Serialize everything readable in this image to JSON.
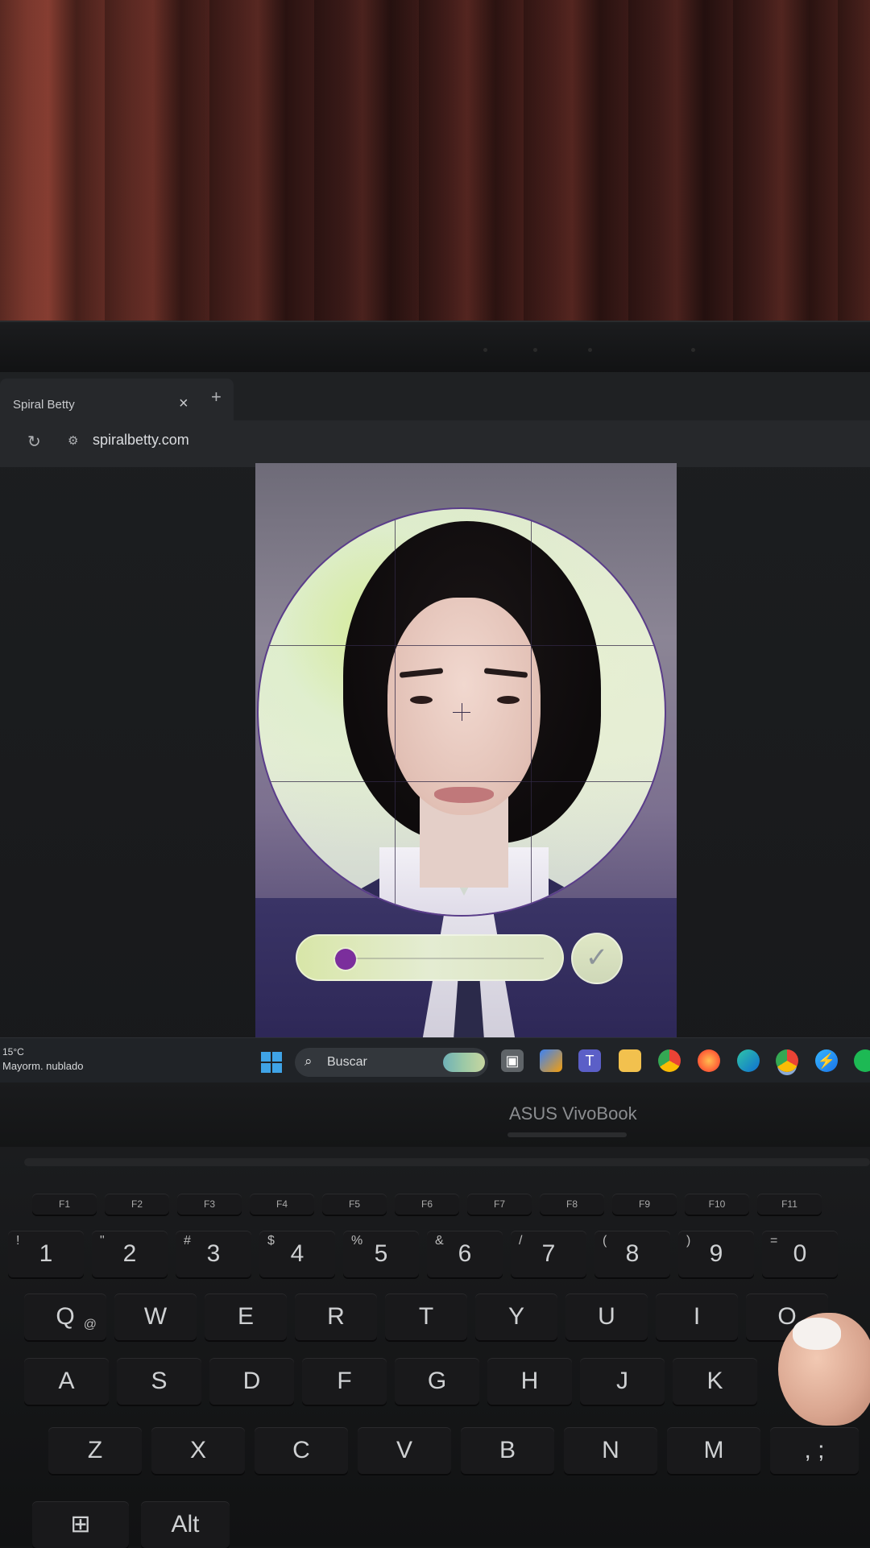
{
  "browser": {
    "tab_title": "Spiral Betty",
    "tab_close": "×",
    "new_tab": "+",
    "reload_icon": "reload-icon",
    "site_info_icon": "tune-icon",
    "url": "spiralbetty.com"
  },
  "editor": {
    "zoom_level": 0.05,
    "confirm_label": "✓",
    "accent_color": "#7b2e9c"
  },
  "taskbar": {
    "weather_temp": "15°C",
    "weather_condition": "Mayorm. nublado",
    "search_placeholder": "Buscar",
    "pinned_icons": [
      "task-view-icon",
      "copilot-icon",
      "teams-icon",
      "file-explorer-icon",
      "chrome-icon",
      "firefox-icon",
      "edge-icon",
      "chrome-profile-icon",
      "messenger-icon",
      "spotify-icon"
    ]
  },
  "laptop": {
    "brand": "ASUS VivoBook"
  },
  "keyboard": {
    "fn_row": [
      "F1",
      "F2",
      "F3",
      "F4",
      "F5",
      "F6",
      "F7",
      "F8",
      "F9",
      "F10",
      "F11"
    ],
    "number_row": [
      "1",
      "2",
      "3",
      "4",
      "5",
      "6",
      "7",
      "8",
      "9",
      "0"
    ],
    "number_row_shift": [
      "!",
      "\"",
      "#",
      "$",
      "%",
      "&",
      "/",
      "(",
      ")",
      "="
    ],
    "top_row": [
      "Q",
      "W",
      "E",
      "R",
      "T",
      "Y",
      "U",
      "I",
      "O"
    ],
    "q_alt": "@",
    "home_row": [
      "A",
      "S",
      "D",
      "F",
      "G",
      "H",
      "J",
      "K"
    ],
    "bottom_row": [
      "Z",
      "X",
      "C",
      "V",
      "B",
      "N",
      "M"
    ],
    "bottom_row_extra": ", ;",
    "alt_label": "Alt"
  }
}
